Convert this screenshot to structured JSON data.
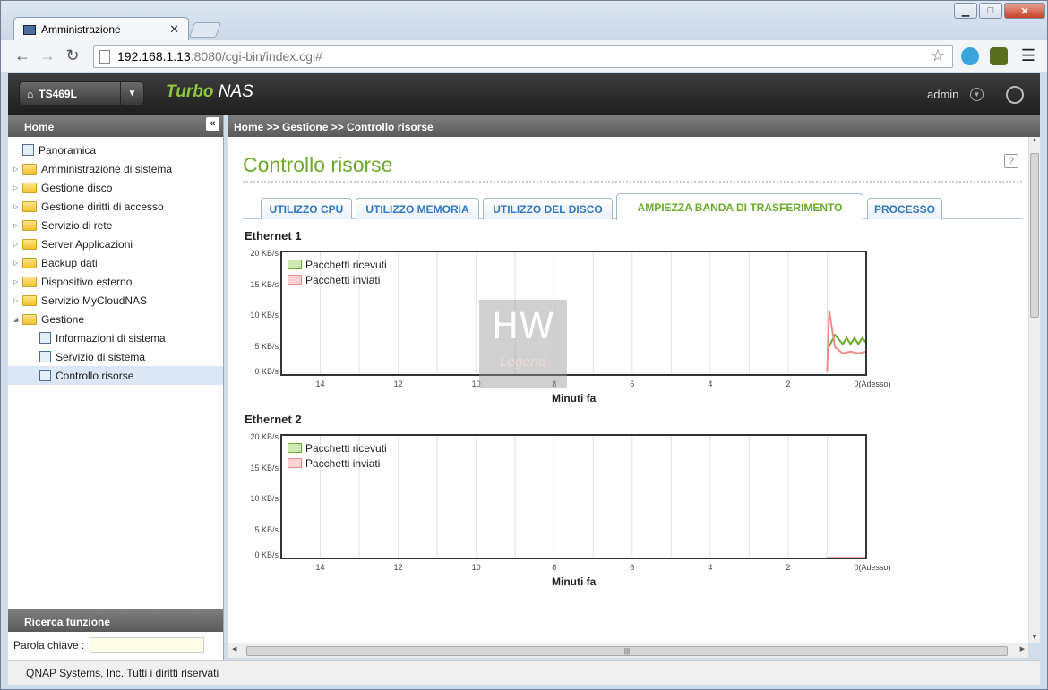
{
  "browser": {
    "tab_title": "Amministrazione",
    "url_host": "192.168.1.13",
    "url_rest": ":8080/cgi-bin/index.cgi#"
  },
  "header": {
    "device": "TS469L",
    "brand_turbo": "Turbo",
    "brand_nas": "NAS",
    "user": "admin"
  },
  "sidebar": {
    "title": "Home",
    "items": [
      {
        "label": "Panoramica"
      },
      {
        "label": "Amministrazione di sistema"
      },
      {
        "label": "Gestione disco"
      },
      {
        "label": "Gestione diritti di accesso"
      },
      {
        "label": "Servizio di rete"
      },
      {
        "label": "Server Applicazioni"
      },
      {
        "label": "Backup dati"
      },
      {
        "label": "Dispositivo esterno"
      },
      {
        "label": "Servizio MyCloudNAS"
      },
      {
        "label": "Gestione"
      }
    ],
    "children": [
      {
        "label": "Informazioni di sistema"
      },
      {
        "label": "Servizio di sistema"
      },
      {
        "label": "Controllo risorse"
      }
    ],
    "search_title": "Ricerca funzione",
    "keyword_label": "Parola chiave :",
    "keyword_value": ""
  },
  "content": {
    "breadcrumb": "Home >> Gestione >> Controllo risorse",
    "title": "Controllo risorse",
    "tabs": [
      {
        "label": "UTILIZZO CPU"
      },
      {
        "label": "UTILIZZO MEMORIA"
      },
      {
        "label": "UTILIZZO DEL DISCO"
      },
      {
        "label": "AMPIEZZA BANDA DI TRASFERIMENTO"
      },
      {
        "label": "PROCESSO"
      }
    ],
    "active_tab": 3
  },
  "watermark": {
    "text": "HW",
    "sub": "Legend"
  },
  "footer": "QNAP Systems, Inc. Tutti i diritti riservati",
  "colors": {
    "accent": "#6aaa28",
    "tab_text": "#2f78c4",
    "received": "#6aaa28",
    "sent": "#f08a8a"
  },
  "chart_data": [
    {
      "type": "line",
      "title": "Ethernet 1",
      "xlabel": "Minuti fa",
      "x_ticks": [
        "14",
        "12",
        "10",
        "8",
        "6",
        "4",
        "2",
        "0(Adesso)"
      ],
      "y_ticks": [
        "20 KB/s",
        "15 KB/s",
        "10 KB/s",
        "5 KB/s",
        "0 KB/s"
      ],
      "ylim": [
        0,
        20
      ],
      "xlim": [
        15,
        0
      ],
      "grid": true,
      "legend": "top-left",
      "series": [
        {
          "name": "Pacchetti ricevuti",
          "color": "#6aaa28",
          "x": [
            1.0,
            0.8,
            0.6,
            0.5,
            0.4,
            0.3,
            0.2,
            0.1,
            0.0
          ],
          "y": [
            4.0,
            6.5,
            5.0,
            6.0,
            5.0,
            6.0,
            5.0,
            6.0,
            5.2
          ]
        },
        {
          "name": "Pacchetti inviati",
          "color": "#f08a8a",
          "x": [
            1.0,
            0.95,
            0.8,
            0.6,
            0.4,
            0.2,
            0.0
          ],
          "y": [
            0.5,
            10.5,
            4.5,
            3.5,
            3.8,
            3.5,
            3.8
          ]
        }
      ]
    },
    {
      "type": "line",
      "title": "Ethernet 2",
      "xlabel": "Minuti fa",
      "x_ticks": [
        "14",
        "12",
        "10",
        "8",
        "6",
        "4",
        "2",
        "0(Adesso)"
      ],
      "y_ticks": [
        "20 KB/s",
        "15 KB/s",
        "10 KB/s",
        "5 KB/s",
        "0 KB/s"
      ],
      "ylim": [
        0,
        20
      ],
      "xlim": [
        15,
        0
      ],
      "grid": true,
      "legend": "top-left",
      "series": [
        {
          "name": "Pacchetti ricevuti",
          "color": "#6aaa28",
          "x": [
            1.0,
            0.0
          ],
          "y": [
            0,
            0
          ]
        },
        {
          "name": "Pacchetti inviati",
          "color": "#f08a8a",
          "x": [
            1.0,
            0.0
          ],
          "y": [
            0.1,
            0.1
          ]
        }
      ]
    }
  ]
}
